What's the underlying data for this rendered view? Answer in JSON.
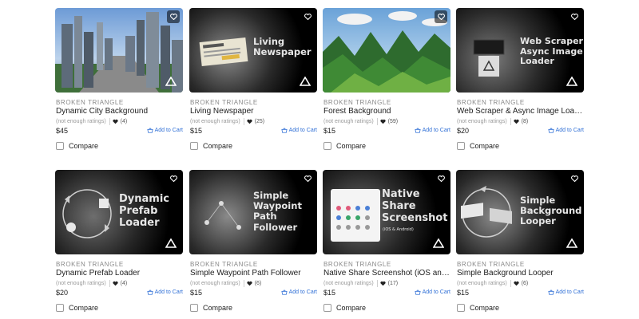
{
  "products": [
    {
      "thumb_text": "",
      "publisher": "BROKEN TRIANGLE",
      "title": "Dynamic City Background",
      "ratings_note": "(not enough ratings)",
      "favorites": "(4)",
      "price": "$45",
      "cart_label": "Add to Cart",
      "compare_label": "Compare"
    },
    {
      "thumb_text": "Living\nNewspaper",
      "publisher": "BROKEN TRIANGLE",
      "title": "Living Newspaper",
      "ratings_note": "(not enough ratings)",
      "favorites": "(25)",
      "price": "$15",
      "cart_label": "Add to Cart",
      "compare_label": "Compare"
    },
    {
      "thumb_text": "",
      "publisher": "BROKEN TRIANGLE",
      "title": "Forest Background",
      "ratings_note": "(not enough ratings)",
      "favorites": "(59)",
      "price": "$15",
      "cart_label": "Add to Cart",
      "compare_label": "Compare"
    },
    {
      "thumb_text": "Web Scraper\nAsync Image\nLoader",
      "publisher": "BROKEN TRIANGLE",
      "title": "Web Scraper & Async Image Loader",
      "ratings_note": "(not enough ratings)",
      "favorites": "(8)",
      "price": "$20",
      "cart_label": "Add to Cart",
      "compare_label": "Compare"
    },
    {
      "thumb_text": "Dynamic\nPrefab\nLoader",
      "publisher": "BROKEN TRIANGLE",
      "title": "Dynamic Prefab Loader",
      "ratings_note": "(not enough ratings)",
      "favorites": "(4)",
      "price": "$20",
      "cart_label": "Add to Cart",
      "compare_label": "Compare"
    },
    {
      "thumb_text": "Simple\nWaypoint\nPath\nFollower",
      "publisher": "BROKEN TRIANGLE",
      "title": "Simple Waypoint Path Follower",
      "ratings_note": "(not enough ratings)",
      "favorites": "(6)",
      "price": "$15",
      "cart_label": "Add to Cart",
      "compare_label": "Compare"
    },
    {
      "thumb_text": "Native\nShare\nScreenshot",
      "thumb_subtext": "(iOS & Android)",
      "publisher": "BROKEN TRIANGLE",
      "title": "Native Share Screenshot (iOS and An...",
      "ratings_note": "(not enough ratings)",
      "favorites": "(17)",
      "price": "$15",
      "cart_label": "Add to Cart",
      "compare_label": "Compare"
    },
    {
      "thumb_text": "Simple\nBackground\nLooper",
      "publisher": "BROKEN TRIANGLE",
      "title": "Simple Background Looper",
      "ratings_note": "(not enough ratings)",
      "favorites": "(6)",
      "price": "$15",
      "cart_label": "Add to Cart",
      "compare_label": "Compare"
    }
  ],
  "colors": {
    "link": "#2f6fd6",
    "muted": "#8a8a8a",
    "text": "#212121"
  },
  "icons": {
    "favorite": "heart-outline-icon",
    "rating": "heart-filled-icon",
    "cart": "cart-icon",
    "brand": "triangle-logo-icon"
  }
}
